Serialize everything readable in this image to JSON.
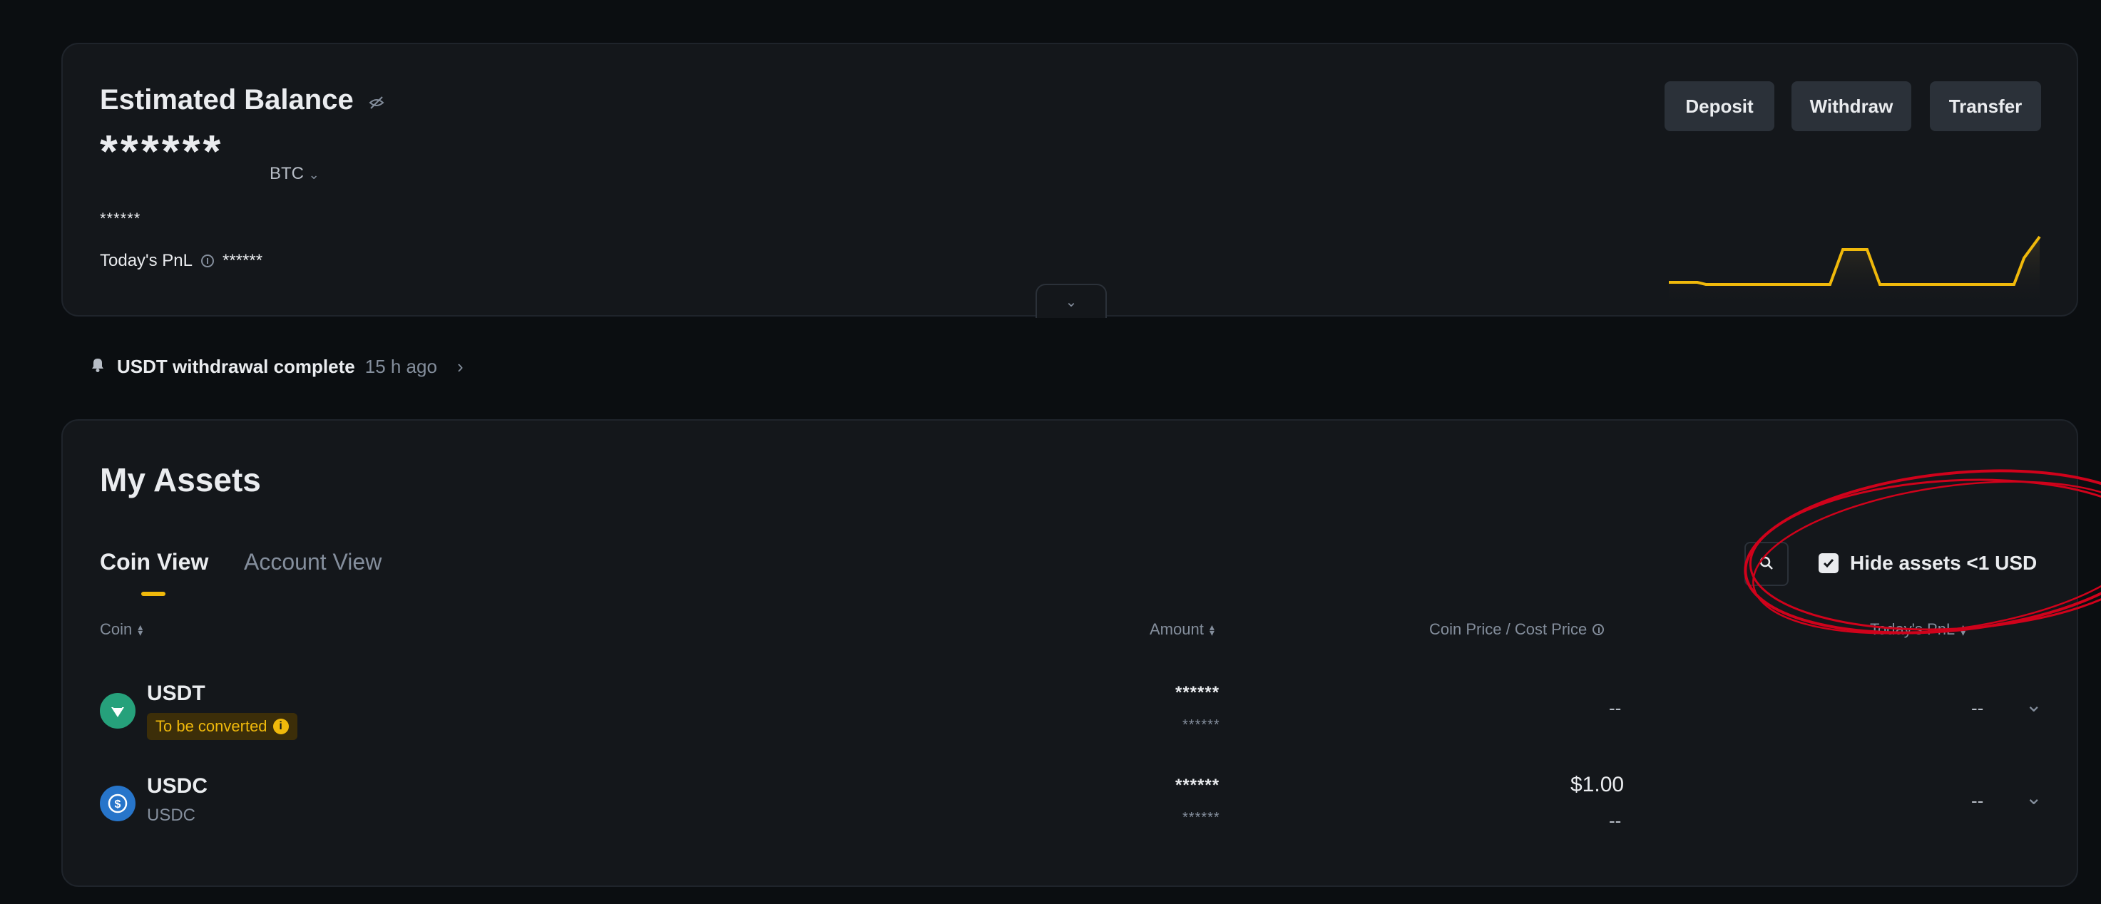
{
  "balance": {
    "title": "Estimated Balance",
    "amount_masked": "******",
    "unit": "BTC",
    "sub_masked": "******",
    "pnl_label": "Today's PnL",
    "pnl_masked": "******",
    "icons": {
      "visibility": "eye-off-icon",
      "unit_dropdown": "chevron-down-icon",
      "pnl_info": "info-icon",
      "expand": "chevron-down-icon"
    }
  },
  "actions": {
    "deposit": "Deposit",
    "withdraw": "Withdraw",
    "transfer": "Transfer"
  },
  "notification": {
    "message": "USDT withdrawal complete",
    "time": "15 h ago",
    "arrow": "›",
    "icon": "bell-icon"
  },
  "assets": {
    "title": "My Assets",
    "tabs": [
      {
        "label": "Coin View",
        "active": true
      },
      {
        "label": "Account View",
        "active": false
      }
    ],
    "hide_small_label": "Hide assets <1 USD",
    "hide_small_checked": true,
    "columns": {
      "coin": "Coin",
      "amount": "Amount",
      "price": "Coin Price / Cost Price",
      "pnl": "Today's PnL"
    },
    "rows": [
      {
        "name": "USDT",
        "badge": "To be converted",
        "amount_masked": "******",
        "amount_sub_masked": "******",
        "price": "--",
        "cost_price": "",
        "pnl": "--",
        "icon": "tether-icon"
      },
      {
        "name": "USDC",
        "subname": "USDC",
        "amount_masked": "******",
        "amount_sub_masked": "******",
        "price": "$1.00",
        "cost_price": "--",
        "pnl": "--",
        "icon": "usdc-icon"
      }
    ]
  },
  "colors": {
    "background": "#0b0e11",
    "card": "#14171b",
    "accent": "#f0b90b",
    "annotation": "#d0021b",
    "usdt": "#26a17b",
    "usdc": "#2775ca"
  }
}
